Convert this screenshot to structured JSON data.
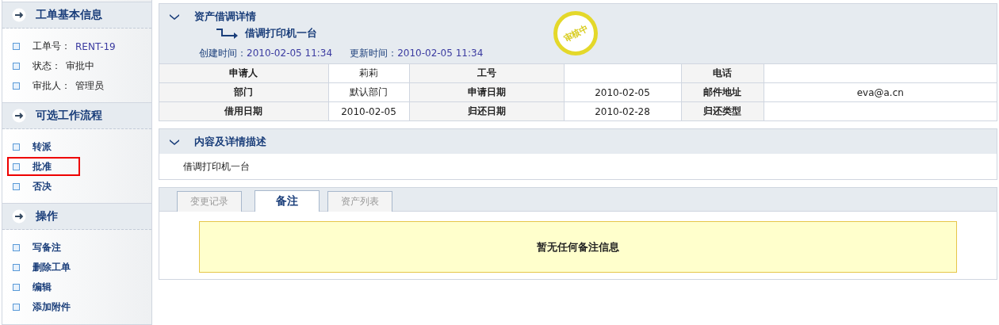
{
  "sidebar": {
    "sections": [
      {
        "title": "工单基本信息",
        "kind": "info",
        "items": [
          {
            "label": "工单号：",
            "value": "RENT-19"
          },
          {
            "label": "状态：",
            "value": "审批中"
          },
          {
            "label": "审批人：",
            "value": "管理员"
          }
        ]
      },
      {
        "title": "可选工作流程",
        "kind": "links",
        "items": [
          {
            "label": "转派",
            "selected": false
          },
          {
            "label": "批准",
            "selected": true
          },
          {
            "label": "否决",
            "selected": false
          }
        ]
      },
      {
        "title": "操作",
        "kind": "links",
        "items": [
          {
            "label": "写备注",
            "selected": false
          },
          {
            "label": "删除工单",
            "selected": false
          },
          {
            "label": "编辑",
            "selected": false
          },
          {
            "label": "添加附件",
            "selected": false
          }
        ]
      }
    ]
  },
  "details": {
    "title": "资产借调详情",
    "subject": "借调打印机一台",
    "stamp": "审核中",
    "created_label": "创建时间：",
    "created": "2010-02-05 11:34",
    "updated_label": "更新时间：",
    "updated": "2010-02-05 11:34",
    "rows": [
      [
        "申请人",
        "莉莉",
        "工号",
        "",
        "电话",
        ""
      ],
      [
        "部门",
        "默认部门",
        "申请日期",
        "2010-02-05",
        "邮件地址",
        "eva@a.cn"
      ],
      [
        "借用日期",
        "2010-02-05",
        "归还日期",
        "2010-02-28",
        "归还类型",
        ""
      ]
    ]
  },
  "description": {
    "title": "内容及详情描述",
    "text": "借调打印机一台"
  },
  "tabs": [
    {
      "label": "变更记录",
      "selected": false
    },
    {
      "label": "备注",
      "selected": true
    },
    {
      "label": "资产列表",
      "selected": false
    }
  ],
  "notice": "暂无任何备注信息"
}
